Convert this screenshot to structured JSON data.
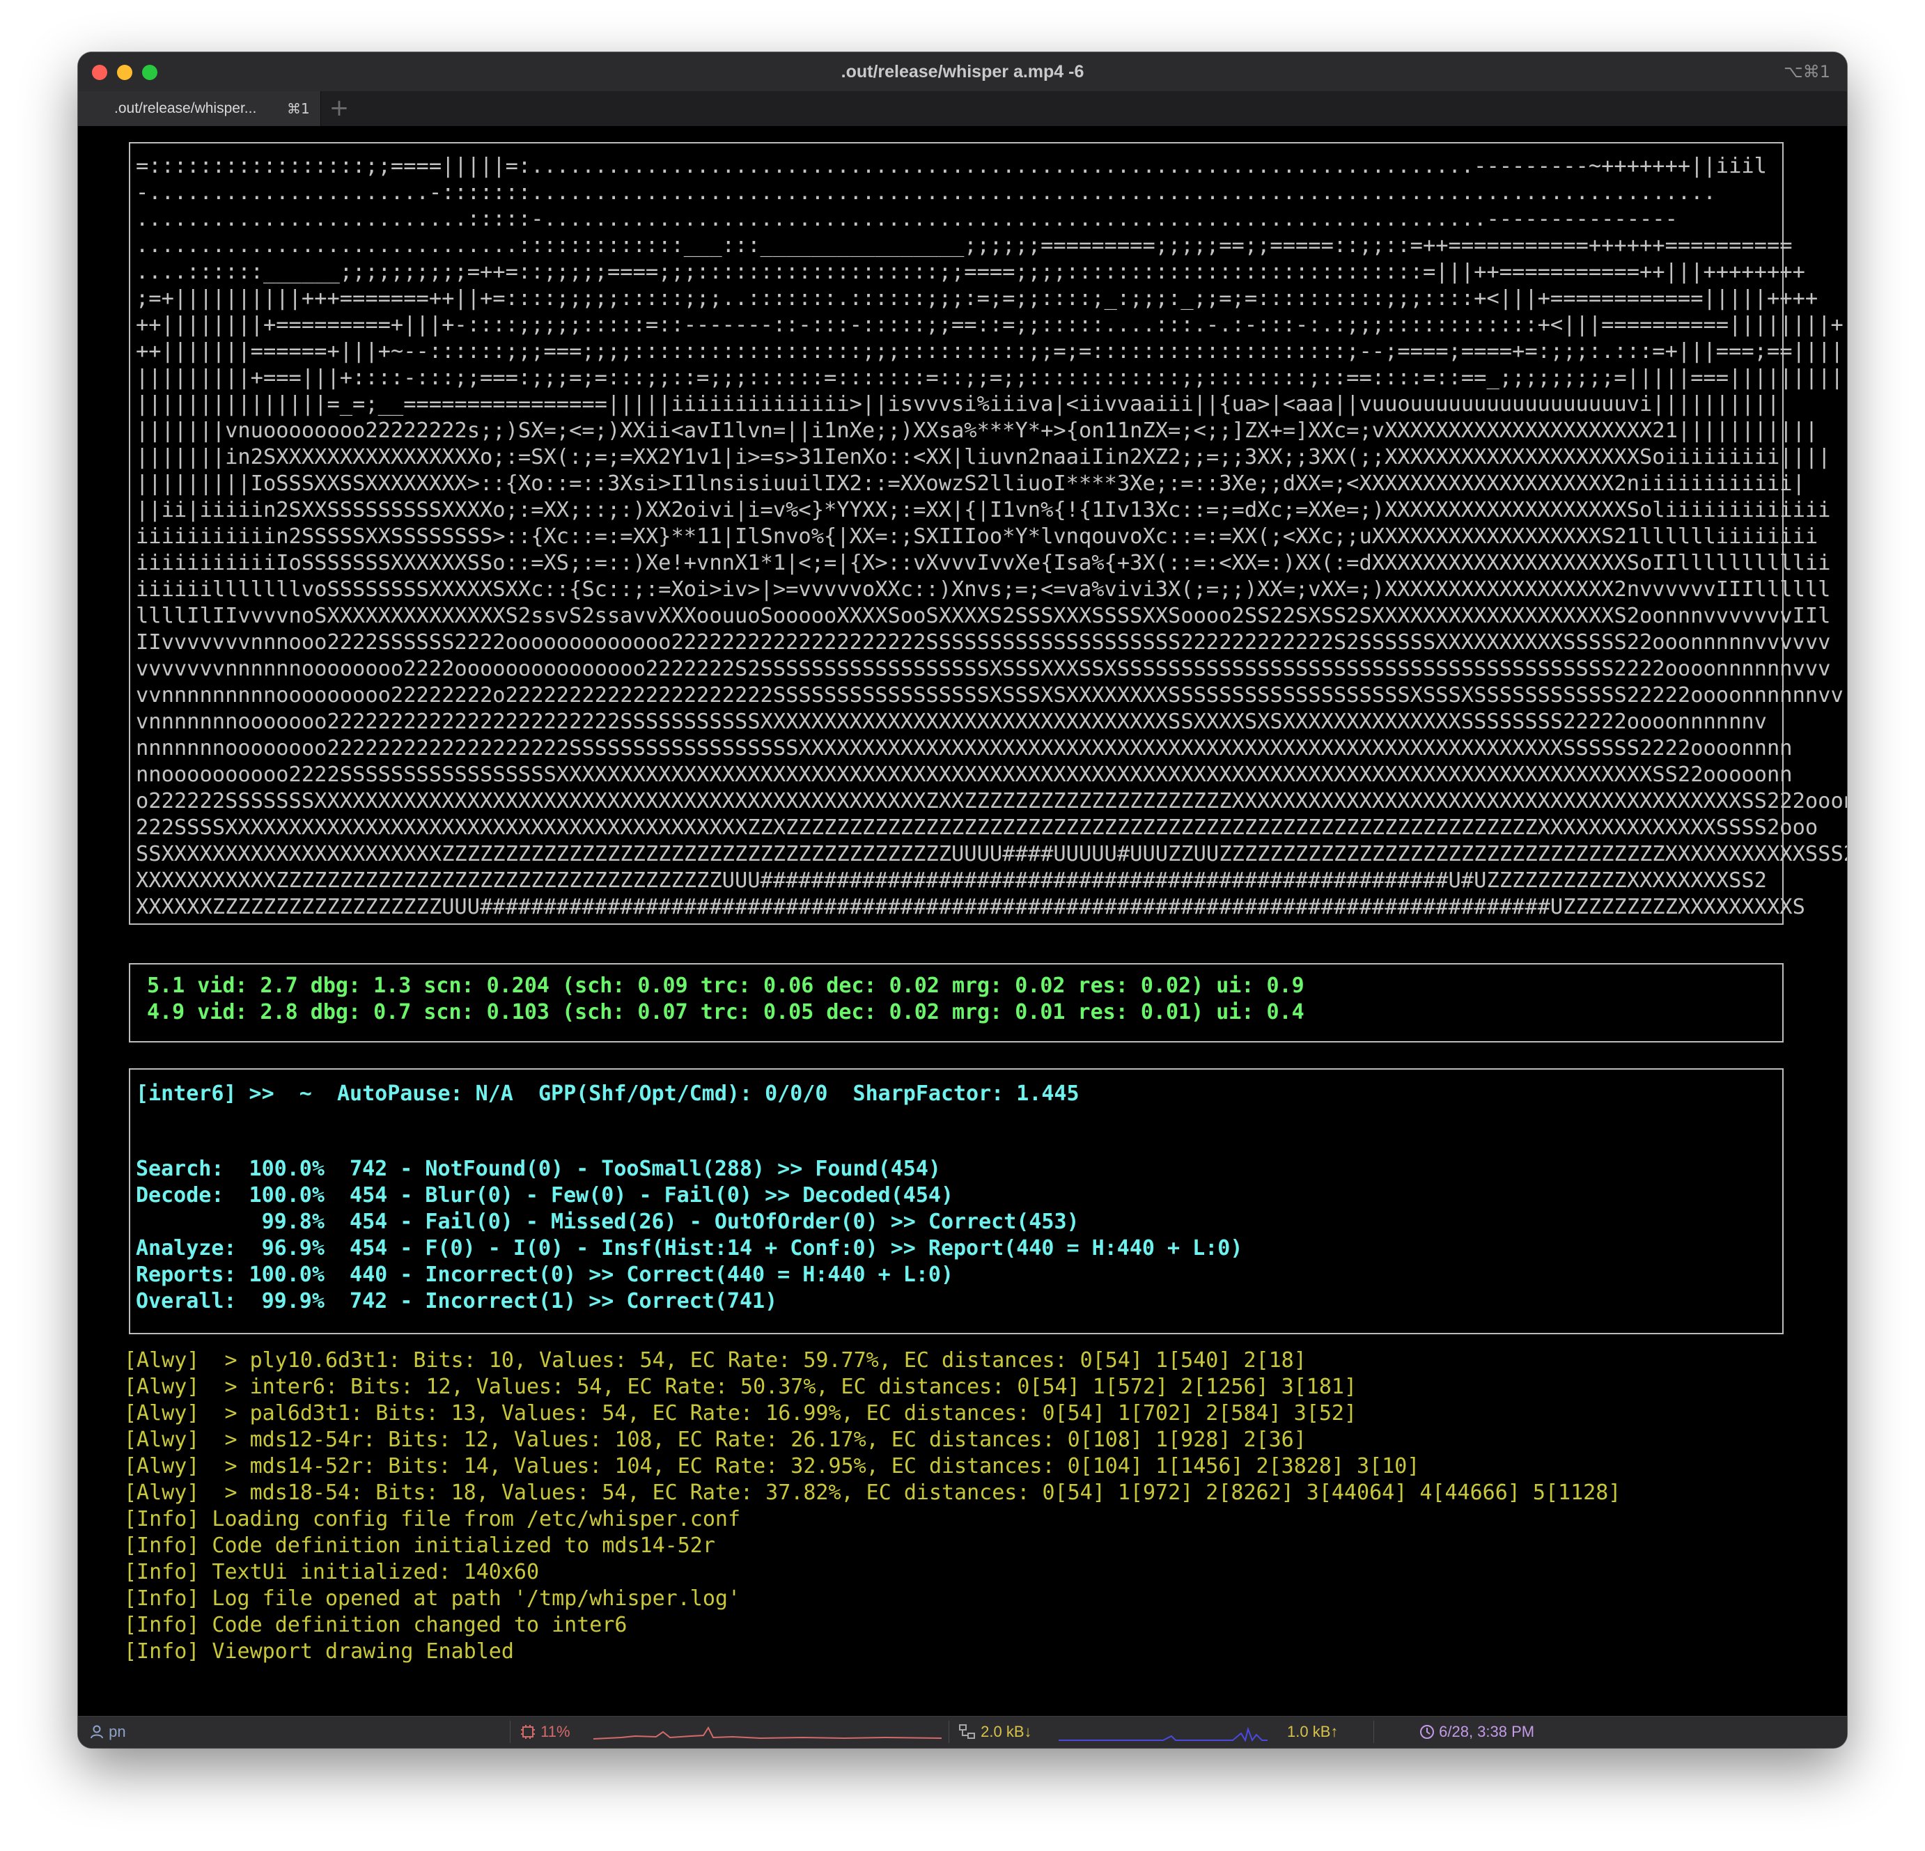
{
  "window": {
    "title": ".out/release/whisper a.mp4 -6",
    "shortcut": "⌥⌘1"
  },
  "tab": {
    "label": ".out/release/whisper...",
    "shortcut": "⌘1",
    "add": "+"
  },
  "viewport": {
    "lines": [
      "=:::::::::::::::::;;====|||||=:..........................................................................---------~+++++++||iiil",
      "-......................-:::::::.............................................................................................",
      "..........................:::::-..........................................................................---------------",
      "..............................:::::::::::::___:::________________;;;;;;=========;;;;;==;;=====::;;::=++===========++++++==========",
      "....::::::______;;;;;;;;;;=++=::;;;;;====;;;:::::::::::::::::::;;====;;;;::::::::::::::::::::::::::::=|||++===========++|||++++++++",
      ";=+||||||||||+++=======++||+=::::;;;;;:::::;;;..:::::::.::::::;;;:=;=;;::::;_:;;;:_;;=;=::::::::::;;;::::+<|||+============|||||++++",
      "++||||||||+=========+|||+-::::;;;;;:::::=::-------::-:::-:::::;;==::=;;:::::....:::.-.:-:::-:.:;;;::::::::::::+<|||==========||||||||+",
      "++|||||||======+|||+~--::::::;;;===;;;;::::::::::::::::::;;;::::::::::;;=;=::::::::::::::::::::;--;====;====+=:;;;:.:::=+|||===;==||||||||||",
      "|||||||||+===|||+::::-:::;;===:;;;=;=:::;;::=;;;::::::=:::::::=::;;=;;::::::::::::;;::::::::;::==::::=::==_;;;;;;;;;=|||||===||||||||||",
      "|||||||||||||||=_=;__================|||||iiiiiiiiiiiiii>||isvvvsi%iiiva|<iivvaaiii||{ua>|<aaa||vuuouuuuuuuuuuuuuuuuuvi||||||||||",
      "|||||||vnuoooooooo22222222s;;)SX=;<=;)XXii<avI1lvn=||i1nXe;;)XXsa%***Y*+>{on11nZX=;<;;]ZX+=]XXc=;vXXXXXXXXXXXXXXXXXXXXX21|||||||||||",
      "|||||||in2SXXXXXXXXXXXXXXXXo;:=SX(:;=;=XX2Y1v1|i>=s>31IenXo::<XX|liuvn2naaiIin2XZ2;;=;;3XX;;3XX(;;XXXXXXXXXXXXXXXXXXXXSoiiiiiiiii||||",
      "|||||||||IoSSSXXSSXXXXXXXX>::{Xo::=::3Xsi>I1lnsisiuuilIX2::=XXowzS2lliuoI****3Xe;:=::3Xe;;dXX=;<XXXXXXXXXXXXXXXXXXXX2niiiiiiiiiiii|",
      "||ii|iiiiin2SXXSSSSSSSSSXXXXo;:=XX;::;:)XX2oivi|i=v%<}*YYXX;:=XX|{|I1vn%{!{1Iv13Xc::=;=dXc;=XXe=;)XXXXXXXXXXXXXXXXXXXSoliiiiiiiiiiiii",
      "iiiiiiiiiiin2SSSSSXXSSSSSSSS>::{Xc::=:=XX}**11|IlSnvo%{|XX=:;SXIIIoo*Y*lvnqouvoXc::=:=XX(;<XXc;;uXXXXXXXXXXXXXXXXXXS21lllllliiiiiiii",
      "iiiiiiiiiiiIoSSSSSSSXXXXXXSSo::=XS;:=::)Xe!+vnnX1*1|<;=|{X>::vXvvvIvvXe{Isa%{+3X(::=:<XX=:)XX(:=dXXXXXXXXXXXXXXXXXXXXSoIIllllllllllii",
      "iiiiiilllllllvoSSSSSSSSXXXXXSXXc::{Sc::;:=Xoi>iv>|>=vvvvvoXXc::)Xnvs;=;<=va%vivi3X(;=;;)XX=;vXX=;)XXXXXXXXXXXXXXXXXX2nvvvvvvIIIllllll",
      "llllIlIIvvvvnoSXXXXXXXXXXXXXXS2ssvS2ssavvXXXoouuoSoooooXXXXSooSXXXXS2SSSXXXSSSSXXSoooo2SS22SXSS2SXXXXXXXXXXXXXXXXXXXS2oonnnvvvvvvvIIl",
      "IIvvvvvvvnnnooo2222SSSSSS2222ooooooooooooo22222222222222222222SSSSSSSSSSSSSSSSSSSS222222222222S2SSSSSSXXXXXXXXXXSSSSS22ooonnnnnvvvvvv",
      "vvvvvvvnnnnnnoooooooo2222ooooooooooooooo2222222S2SSSSSSSSSSSSSSSSSSXSSSXXXSSXSSSSSSSSSSSSSSSSSSSSSSSSSSSSSSSSSSSSSSS2222oooonnnnnnvvv",
      "vvnnnnnnnnnooooooooo22222222o222222222222222222222SSSSSSSSSSSSSSSSSXSSSXSXXXXXXXXSSSSSSSSSSSSSSSSSSSXSSSXSSSSSSSSSSSS22222oooonnnnnnvv",
      "vnnnnnnnooooooo22222222222222222222222SSSSSSSSSSSXXXXXXXXXXXXXXXXXXXXXXXXXXXXXXXXSSXXXXSXSXXXXXXXXXXXXXXSSSSSSSS22222oooonnnnnnv",
      "nnnnnnnoooooooo2222222222222222222SSSSSSSSSSSSSSSSSSXXXXXXXXXXXXXXXXXXXXXXXXXXXXXXXXXXXXXXXXXXXXXXXXXXXXXXXXXXXXSSSSSS2222oooonnnn",
      "nnoooooooooo2222SSSSSSSSSSSSSSSSSXXXXXXXXXXXXXXXXXXXXXXXXXXXXXXXXXXXXXXXXXXXXXXXXXXXXXXXXXXXXXXXXXXXXXXXXXXXXXXXXXXXXXXSS22ooooonn",
      "o222222SSSSSSSXXXXXXXXXXXXXXXXXXXXXXXXXXXXXXXXXXXXXXXXXXXXXXXXZXXZZZZZZZZZZZZZZZZZZZZZXXXXXXXXXXXXXXXXXXXXXXXXXXXXXXXXXXXXXXXXSS222ooon",
      "222SSSSXXXXXXXXXXXXXXXXXXXXXXXXXXXXXXXXXXXXXXXXXZZXZZZZZZZZZZZZZZZZZZZZZZZZZZZZZZZZZZZZZZZZZZZZZZZZZZZZZZZZZZZXXXXXXXXXXXXXXSSSS2ooo",
      "SSXXXXXXXXXXXXXXXXXXXXXXZZZZZZZZZZZZZZZZZZZZZZZZZZZZZZZZZZZZZZZZUUUU####UUUUU#UUUZZUUZZZZZZZZZZZZZZZZZZZZZZZZZZZZZZZZZZZXXXXXXXXXXXSSS22o",
      "XXXXXXXXXXXZZZZZZZZZZZZZZZZZZZZZZZZZZZZZZZZZZZUUU######################################################U#UZZZZZZZZZZZXXXXXXXXSS2",
      "XXXXXXZZZZZZZZZZZZZZZZZZUUU####################################################################################UZZZZZZZZZXXXXXXXXXS"
    ]
  },
  "timing": {
    "lines": [
      "5.1 vid: 2.7 dbg: 1.3 scn: 0.204 (sch: 0.09 trc: 0.06 dec: 0.02 mrg: 0.02 res: 0.02) ui: 0.9",
      "4.9 vid: 2.8 dbg: 0.7 scn: 0.103 (sch: 0.07 trc: 0.05 dec: 0.02 mrg: 0.01 res: 0.01) ui: 0.4"
    ]
  },
  "stats": {
    "header": "[inter6] >>  ~  AutoPause: N/A  GPP(Shf/Opt/Cmd): 0/0/0  SharpFactor: 1.445",
    "lines": [
      "Search:  100.0%  742 - NotFound(0) - TooSmall(288) >> Found(454)",
      "Decode:  100.0%  454 - Blur(0) - Few(0) - Fail(0) >> Decoded(454)",
      "          99.8%  454 - Fail(0) - Missed(26) - OutOfOrder(0) >> Correct(453)",
      "Analyze:  96.9%  454 - F(0) - I(0) - Insf(Hist:14 + Conf:0) >> Report(440 = H:440 + L:0)",
      "Reports: 100.0%  440 - Incorrect(0) >> Correct(440 = H:440 + L:0)",
      "Overall:  99.9%  742 - Incorrect(1) >> Correct(741)"
    ]
  },
  "log": {
    "lines": [
      "[Alwy]  > ply10.6d3t1: Bits: 10, Values: 54, EC Rate: 59.77%, EC distances: 0[54] 1[540] 2[18]",
      "[Alwy]  > inter6: Bits: 12, Values: 54, EC Rate: 50.37%, EC distances: 0[54] 1[572] 2[1256] 3[181]",
      "[Alwy]  > pal6d3t1: Bits: 13, Values: 54, EC Rate: 16.99%, EC distances: 0[54] 1[702] 2[584] 3[52]",
      "[Alwy]  > mds12-54r: Bits: 12, Values: 108, EC Rate: 26.17%, EC distances: 0[108] 1[928] 2[36]",
      "[Alwy]  > mds14-52r: Bits: 14, Values: 104, EC Rate: 32.95%, EC distances: 0[104] 1[1456] 2[3828] 3[10]",
      "[Alwy]  > mds18-54: Bits: 18, Values: 54, EC Rate: 37.82%, EC distances: 0[54] 1[972] 2[8262] 3[44064] 4[44666] 5[1128]",
      "[Info] Loading config file from /etc/whisper.conf",
      "[Info] Code definition initialized to mds14-52r",
      "[Info] TextUi initialized: 140x60",
      "[Info] Log file opened at path '/tmp/whisper.log'",
      "[Info] Code definition changed to inter6",
      "[Info] Viewport drawing Enabled"
    ]
  },
  "statusbar": {
    "user": "pn",
    "cpu": "11%",
    "net_down": "2.0 kB↓",
    "net_up": "1.0 kB↑",
    "datetime": "6/28, 3:38 PM",
    "colors": {
      "cpu": "#d46a6a",
      "net_down": "#d8c24a",
      "net_up": "#d8c24a",
      "datetime": "#c49be6",
      "user": "#8ea4c8"
    }
  },
  "colors": {
    "viewport_text": "#c4c4c4",
    "timing_text": "#6bf56b",
    "stats_text": "#6ff2ee",
    "log_text": "#c8c83a"
  }
}
